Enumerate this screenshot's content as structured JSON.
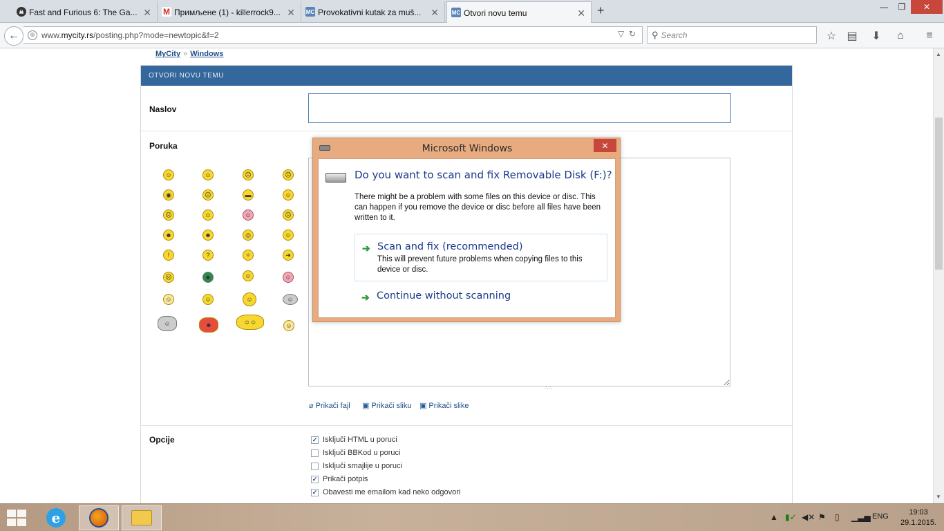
{
  "browser": {
    "tabs": [
      {
        "title": "Fast and Furious 6: The Ga...",
        "favicon": "skull-icon",
        "color": "#333333"
      },
      {
        "title": "Примљене (1) - killerrock9...",
        "favicon": "gmail-icon",
        "color": "#d93025"
      },
      {
        "title": "Provokativni kutak za muš...",
        "favicon": "mycity-icon",
        "color": "#5b84b9"
      },
      {
        "title": "Otvori novu temu",
        "favicon": "mycity-icon",
        "color": "#5b84b9"
      }
    ],
    "active_tab": 3,
    "url_prefix": "www.",
    "url_domain": "mycity.rs",
    "url_path": "/posting.php?mode=newtopic&f=2",
    "search_placeholder": "Search"
  },
  "breadcrumb": {
    "root": "MyCity",
    "separator": "»",
    "current": "Windows"
  },
  "form": {
    "header": "OTVORI NOVU TEMU",
    "subject_label": "Naslov",
    "subject_value": "",
    "message_label": "Poruka",
    "message_value": "",
    "attachments": [
      "Prikači fajl",
      "Prikači sliku",
      "Prikači slike"
    ],
    "options_label": "Opcije",
    "options": [
      {
        "label": "Isključi HTML u poruci",
        "checked": true
      },
      {
        "label": "Isključi BBKod u poruci",
        "checked": false
      },
      {
        "label": "Isključi smajlije u poruci",
        "checked": false
      },
      {
        "label": "Prikači potpis",
        "checked": true
      },
      {
        "label": "Obavesti me emailom kad neko odgovori",
        "checked": true
      }
    ]
  },
  "dialog": {
    "title": "Microsoft Windows",
    "question": "Do you want to scan and fix Removable Disk (F:)?",
    "description": "There might be a problem with some files on this device or disc. This can happen if you remove the device or disc before all files have been written to it.",
    "option1_title": "Scan and fix (recommended)",
    "option1_sub": "This will prevent future problems when copying files to this device or disc.",
    "option2_title": "Continue without scanning"
  },
  "taskbar": {
    "language": "ENG",
    "time": "19:03",
    "date": "29.1.2015."
  },
  "colors": {
    "panel_header": "#34679b",
    "link": "#1f4f89",
    "dialog_frame": "#e7ab7f",
    "close_red": "#c7473b"
  }
}
